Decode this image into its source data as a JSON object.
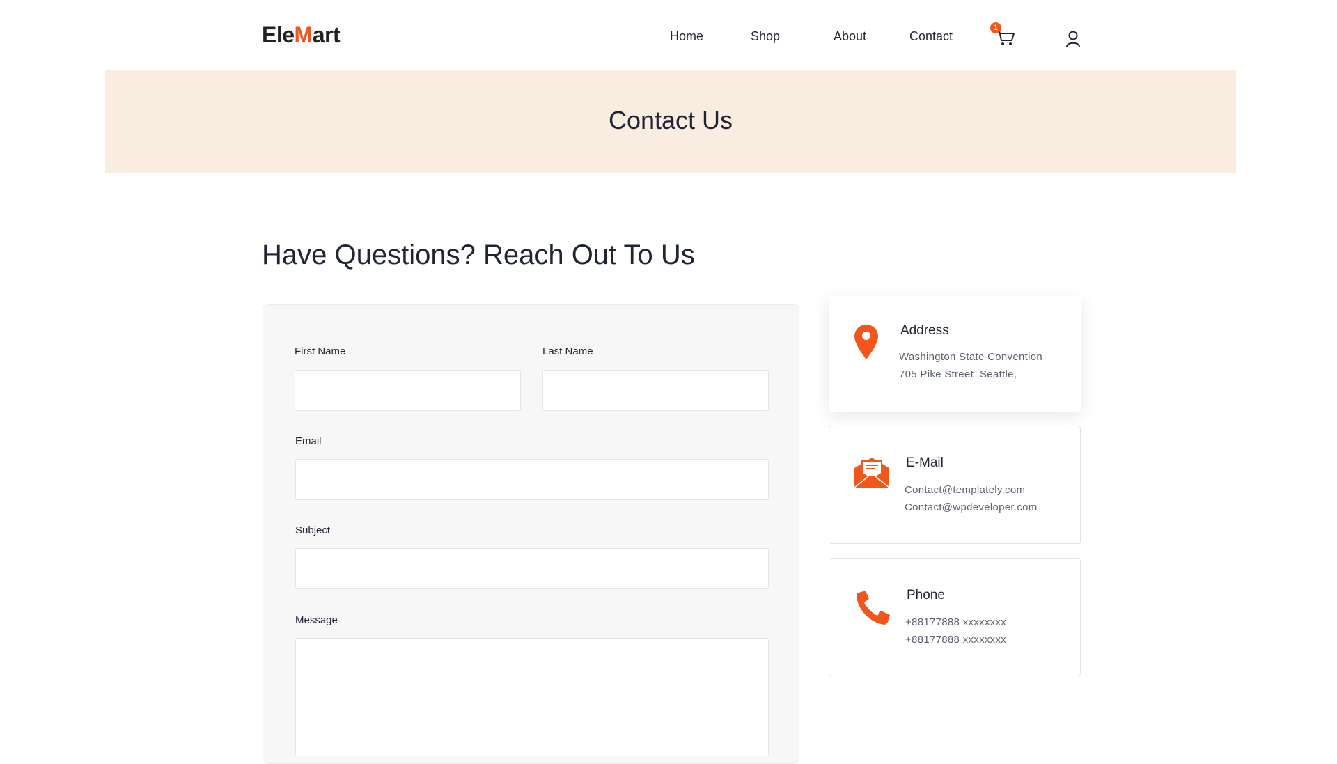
{
  "header": {
    "logo": {
      "prefix": "Ele",
      "mark": "M",
      "suffix": "art"
    },
    "nav": [
      {
        "label": "Home"
      },
      {
        "label": "Shop"
      },
      {
        "label": "About"
      },
      {
        "label": "Contact"
      }
    ],
    "cart_count": "1",
    "cart_icon": "cart-icon",
    "account_icon": "user-icon"
  },
  "banner": {
    "title": "Contact Us"
  },
  "section": {
    "title": "Have Questions? Reach Out To Us"
  },
  "form": {
    "first_name_label": "First Name",
    "first_name_value": "",
    "last_name_label": "Last Name",
    "last_name_value": "",
    "email_label": "Email",
    "email_value": "",
    "subject_label": "Subject",
    "subject_value": "",
    "message_label": "Message",
    "message_value": ""
  },
  "contact_info": {
    "address": {
      "icon": "map-pin-icon",
      "title": "Address",
      "lines": [
        "Washington State Convention",
        "705 Pike Street ,Seattle,"
      ]
    },
    "email": {
      "icon": "envelope-icon",
      "title": "E-Mail",
      "lines": [
        "Contact@templately.com",
        "Contact@wpdeveloper.com"
      ]
    },
    "phone": {
      "icon": "phone-icon",
      "title": "Phone",
      "lines": [
        "+88177888 xxxxxxxx",
        "+88177888 xxxxxxxx"
      ]
    }
  },
  "colors": {
    "accent": "#f2561d",
    "banner_bg": "#f9ede2",
    "text_dark": "#1f2533",
    "text_muted": "#5b6170",
    "form_bg": "#f7f7f7"
  }
}
